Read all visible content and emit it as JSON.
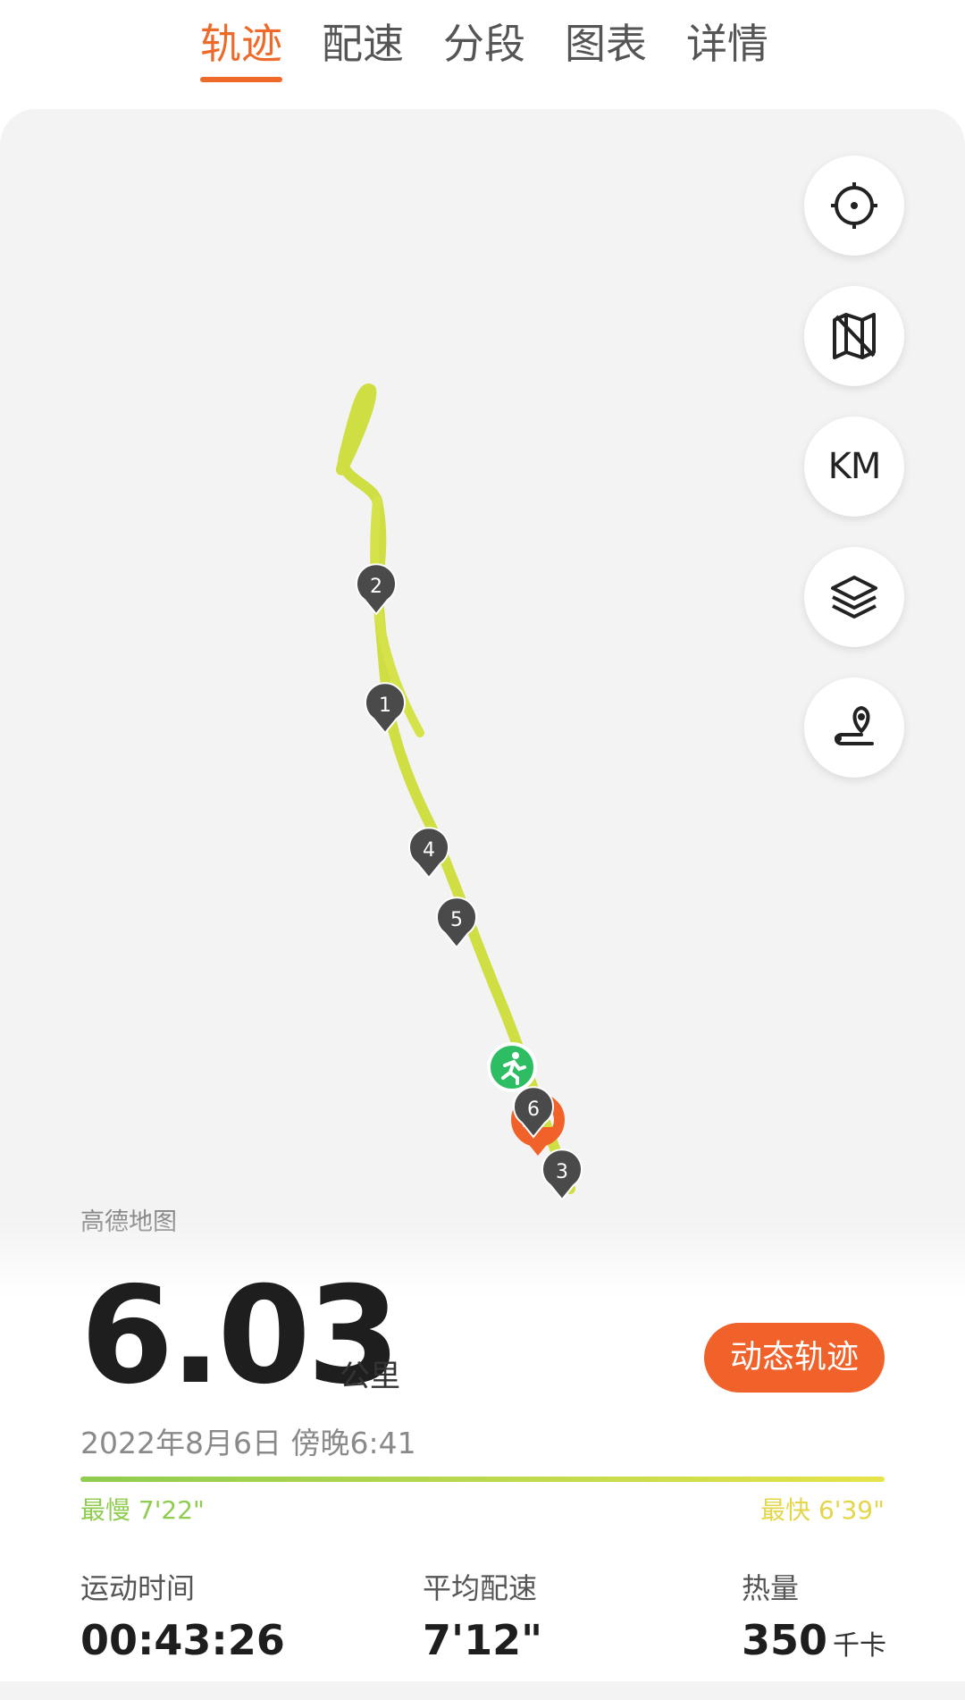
{
  "tabs": [
    {
      "label": "轨迹",
      "active": true
    },
    {
      "label": "配速",
      "active": false
    },
    {
      "label": "分段",
      "active": false
    },
    {
      "label": "图表",
      "active": false
    },
    {
      "label": "详情",
      "active": false
    }
  ],
  "map": {
    "attribution": "高德地图",
    "controls": [
      {
        "name": "locate-icon"
      },
      {
        "name": "map-icon"
      },
      {
        "name": "km-toggle",
        "label": "KM"
      },
      {
        "name": "layers-icon"
      },
      {
        "name": "route-pin-icon"
      }
    ],
    "km_markers": [
      "1",
      "2",
      "3",
      "4",
      "5",
      "6"
    ],
    "colors": {
      "route": "#cfdf43",
      "marker": "#4a4a4a",
      "start": "#2dbd62",
      "end": "#f0622a"
    }
  },
  "summary": {
    "distance": "6.03",
    "distance_unit": "公里",
    "dynamic_track_button": "动态轨迹",
    "datetime": "2022年8月6日 傍晚6:41",
    "slowest": "最慢 7'22\"",
    "fastest": "最快 6'39\""
  },
  "stats": [
    {
      "label": "运动时间",
      "value": "00:43:26",
      "unit": ""
    },
    {
      "label": "平均配速",
      "value": "7'12\"",
      "unit": ""
    },
    {
      "label": "热量",
      "value": "350",
      "unit": "千卡"
    }
  ],
  "accent": "#ee6a2a"
}
